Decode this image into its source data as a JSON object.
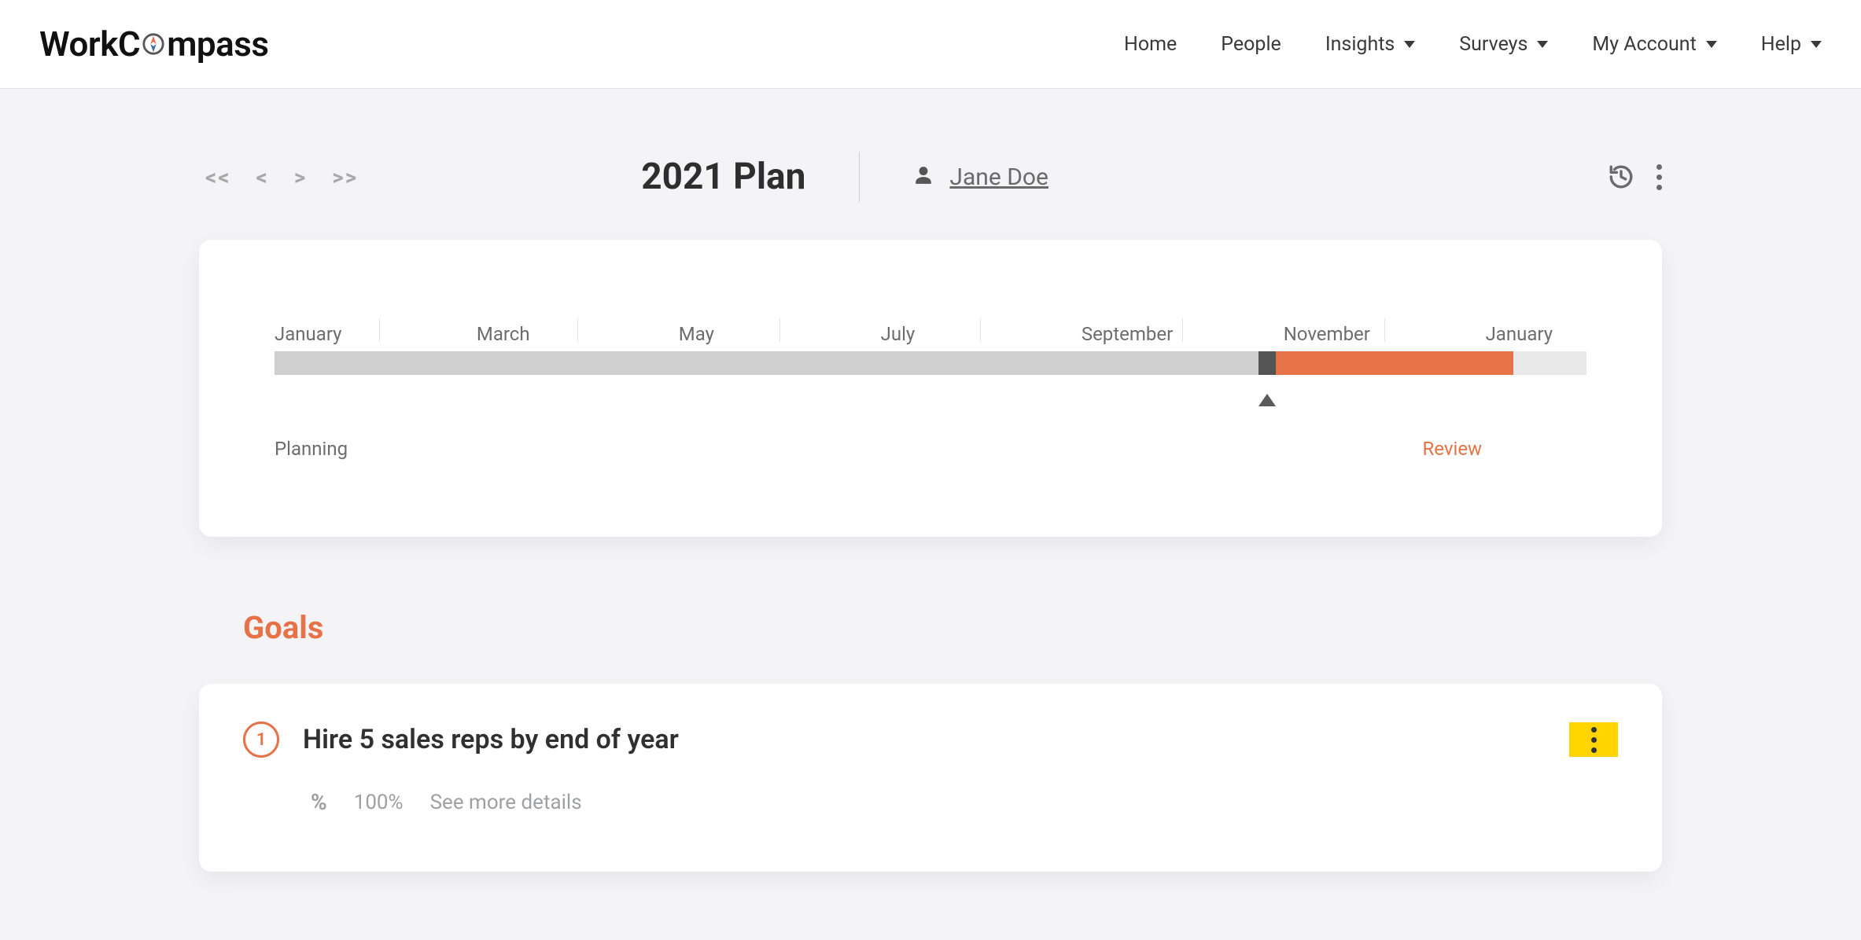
{
  "brand": {
    "prefix": "WorkC",
    "suffix": "mpass"
  },
  "nav": {
    "home": "Home",
    "people": "People",
    "insights": "Insights",
    "surveys": "Surveys",
    "account": "My Account",
    "help": "Help"
  },
  "pager": {
    "first": "<<",
    "prev": "<",
    "next": ">",
    "last": ">>"
  },
  "plan": {
    "title": "2021 Plan",
    "user": "Jane Doe"
  },
  "timeline": {
    "months": [
      "January",
      "March",
      "May",
      "July",
      "September",
      "November",
      "January"
    ],
    "phases": {
      "planning": "Planning",
      "review": "Review"
    }
  },
  "sections": {
    "goals": "Goals"
  },
  "goals": [
    {
      "number": "1",
      "title": "Hire 5 sales reps by end of year",
      "percent": "100%",
      "more": "See more details"
    }
  ]
}
